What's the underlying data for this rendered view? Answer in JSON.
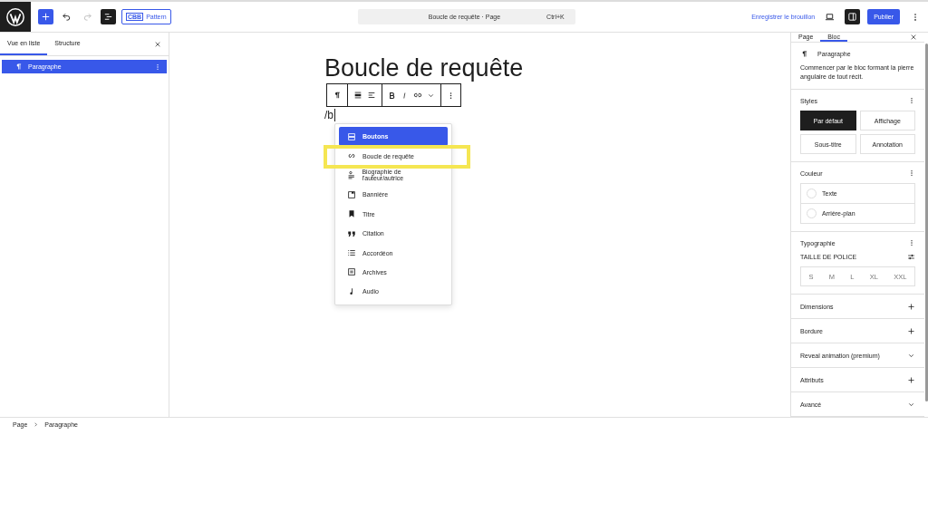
{
  "topbar": {
    "pattern_badge": "CBB",
    "pattern_label": "Pattern",
    "command": {
      "title": "Boucle de requête · Page",
      "shortcut": "Ctrl+K"
    },
    "save_draft": "Enregistrer le brouillon",
    "publish": "Publier",
    "sidebar_toggle_on": true
  },
  "left_panel": {
    "tabs": [
      {
        "label": "Vue en liste",
        "selected": true
      },
      {
        "label": "Structure",
        "selected": false
      }
    ],
    "items": [
      {
        "label": "Paragraphe",
        "selected": true
      }
    ]
  },
  "editor": {
    "title": "Boucle de requête",
    "typed": "/b",
    "menu": [
      {
        "label": "Boutons",
        "kind": "buttons",
        "selected": true,
        "highlighted": false
      },
      {
        "label": "Boucle de requête",
        "kind": "loop",
        "selected": false,
        "highlighted": true
      },
      {
        "label": "Biographie de l'auteur/autrice",
        "kind": "bio",
        "selected": false,
        "highlighted": false
      },
      {
        "label": "Bannière",
        "kind": "cover",
        "selected": false,
        "highlighted": false
      },
      {
        "label": "Titre",
        "kind": "bookmark",
        "selected": false,
        "highlighted": false
      },
      {
        "label": "Citation",
        "kind": "quote",
        "selected": false,
        "highlighted": false
      },
      {
        "label": "Accordéon",
        "kind": "list",
        "selected": false,
        "highlighted": false
      },
      {
        "label": "Archives",
        "kind": "archive",
        "selected": false,
        "highlighted": false
      },
      {
        "label": "Audio",
        "kind": "audio",
        "selected": false,
        "highlighted": false
      }
    ]
  },
  "right_panel": {
    "tabs": [
      {
        "label": "Page",
        "selected": false
      },
      {
        "label": "Bloc",
        "selected": true
      }
    ],
    "block": {
      "name": "Paragraphe",
      "description": "Commencer par le bloc formant la pierre angulaire de tout récit."
    },
    "styles": {
      "title": "Styles",
      "options": [
        {
          "label": "Par défaut",
          "selected": true
        },
        {
          "label": "Affichage",
          "selected": false
        },
        {
          "label": "Sous-titre",
          "selected": false
        },
        {
          "label": "Annotation",
          "selected": false
        }
      ]
    },
    "color": {
      "title": "Couleur",
      "items": [
        "Texte",
        "Arrière-plan"
      ]
    },
    "typography": {
      "title": "Typographie",
      "label": "TAILLE DE POLICE",
      "sizes": [
        "S",
        "M",
        "L",
        "XL",
        "XXL"
      ]
    },
    "sections": [
      {
        "label": "Dimensions",
        "kind": "plus"
      },
      {
        "label": "Bordure",
        "kind": "plus"
      },
      {
        "label": "Reveal animation (premium)",
        "kind": "chevron"
      },
      {
        "label": "Attributs",
        "kind": "plus"
      },
      {
        "label": "Avancé",
        "kind": "chevron"
      }
    ]
  },
  "breadcrumb": [
    "Page",
    "Paragraphe"
  ]
}
